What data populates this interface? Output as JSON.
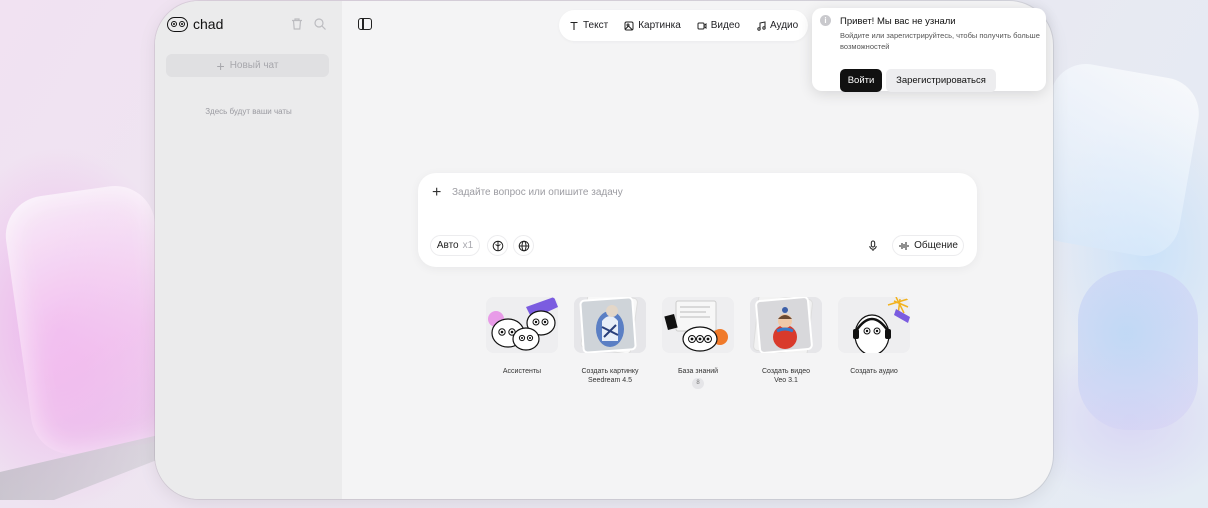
{
  "app": {
    "name": "chad"
  },
  "sidebar": {
    "new_chat_label": "Новый чат",
    "empty_text": "Здесь будут ваши чаты"
  },
  "tabs": [
    {
      "label": "Текст",
      "icon": "text-icon"
    },
    {
      "label": "Картинка",
      "icon": "image-icon"
    },
    {
      "label": "Видео",
      "icon": "video-icon"
    },
    {
      "label": "Аудио",
      "icon": "audio-icon"
    }
  ],
  "input": {
    "placeholder": "Задайте вопрос или опишите задачу",
    "mode_label": "Авто",
    "mode_multiplier": "x1",
    "voice_label": "Общение"
  },
  "features": [
    {
      "label": "Ассистенты"
    },
    {
      "label": "Создать картинку",
      "sub": "Seedream 4.5"
    },
    {
      "label": "База знаний",
      "count": "8"
    },
    {
      "label": "Создать видео",
      "sub": "Veo 3.1"
    },
    {
      "label": "Создать аудио"
    }
  ],
  "toast": {
    "title": "Привет! Мы вас не узнали",
    "text": "Войдите или зарегистрируйтесь, чтобы получить больше возможностей",
    "login_label": "Войти",
    "register_label": "Зарегистрироваться"
  },
  "colors": {
    "accent_dark": "#111111",
    "background": "#f4f4f5",
    "sidebar": "#ebebec"
  }
}
